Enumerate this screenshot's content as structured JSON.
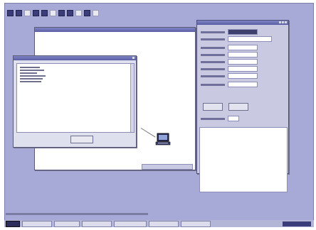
{
  "menubar": {
    "items": [
      "",
      "",
      "",
      ""
    ]
  },
  "canvas": {
    "title": ""
  },
  "message_dialog": {
    "title": "",
    "lines": [
      "",
      "",
      "",
      "",
      "",
      ""
    ],
    "ok_label": ""
  },
  "properties": {
    "title": "",
    "rows": [
      {
        "label": "",
        "value": ""
      },
      {
        "label": "",
        "value": ""
      },
      {
        "label": "",
        "value": ""
      },
      {
        "label": "",
        "value": ""
      },
      {
        "label": "",
        "value": ""
      },
      {
        "label": "",
        "value": ""
      },
      {
        "label": "",
        "value": ""
      },
      {
        "label": "",
        "value": ""
      }
    ],
    "button_1": "",
    "button_2": "",
    "extra_label": "",
    "extra_value": ""
  },
  "statusbar": {
    "text": ""
  },
  "taskbar": {
    "tasks": [
      "",
      "",
      "",
      "",
      "",
      "",
      ""
    ]
  },
  "colors": {
    "accent": "#5a5fa6",
    "desktop": "#a7a9d6",
    "window": "#f4f4f6"
  }
}
